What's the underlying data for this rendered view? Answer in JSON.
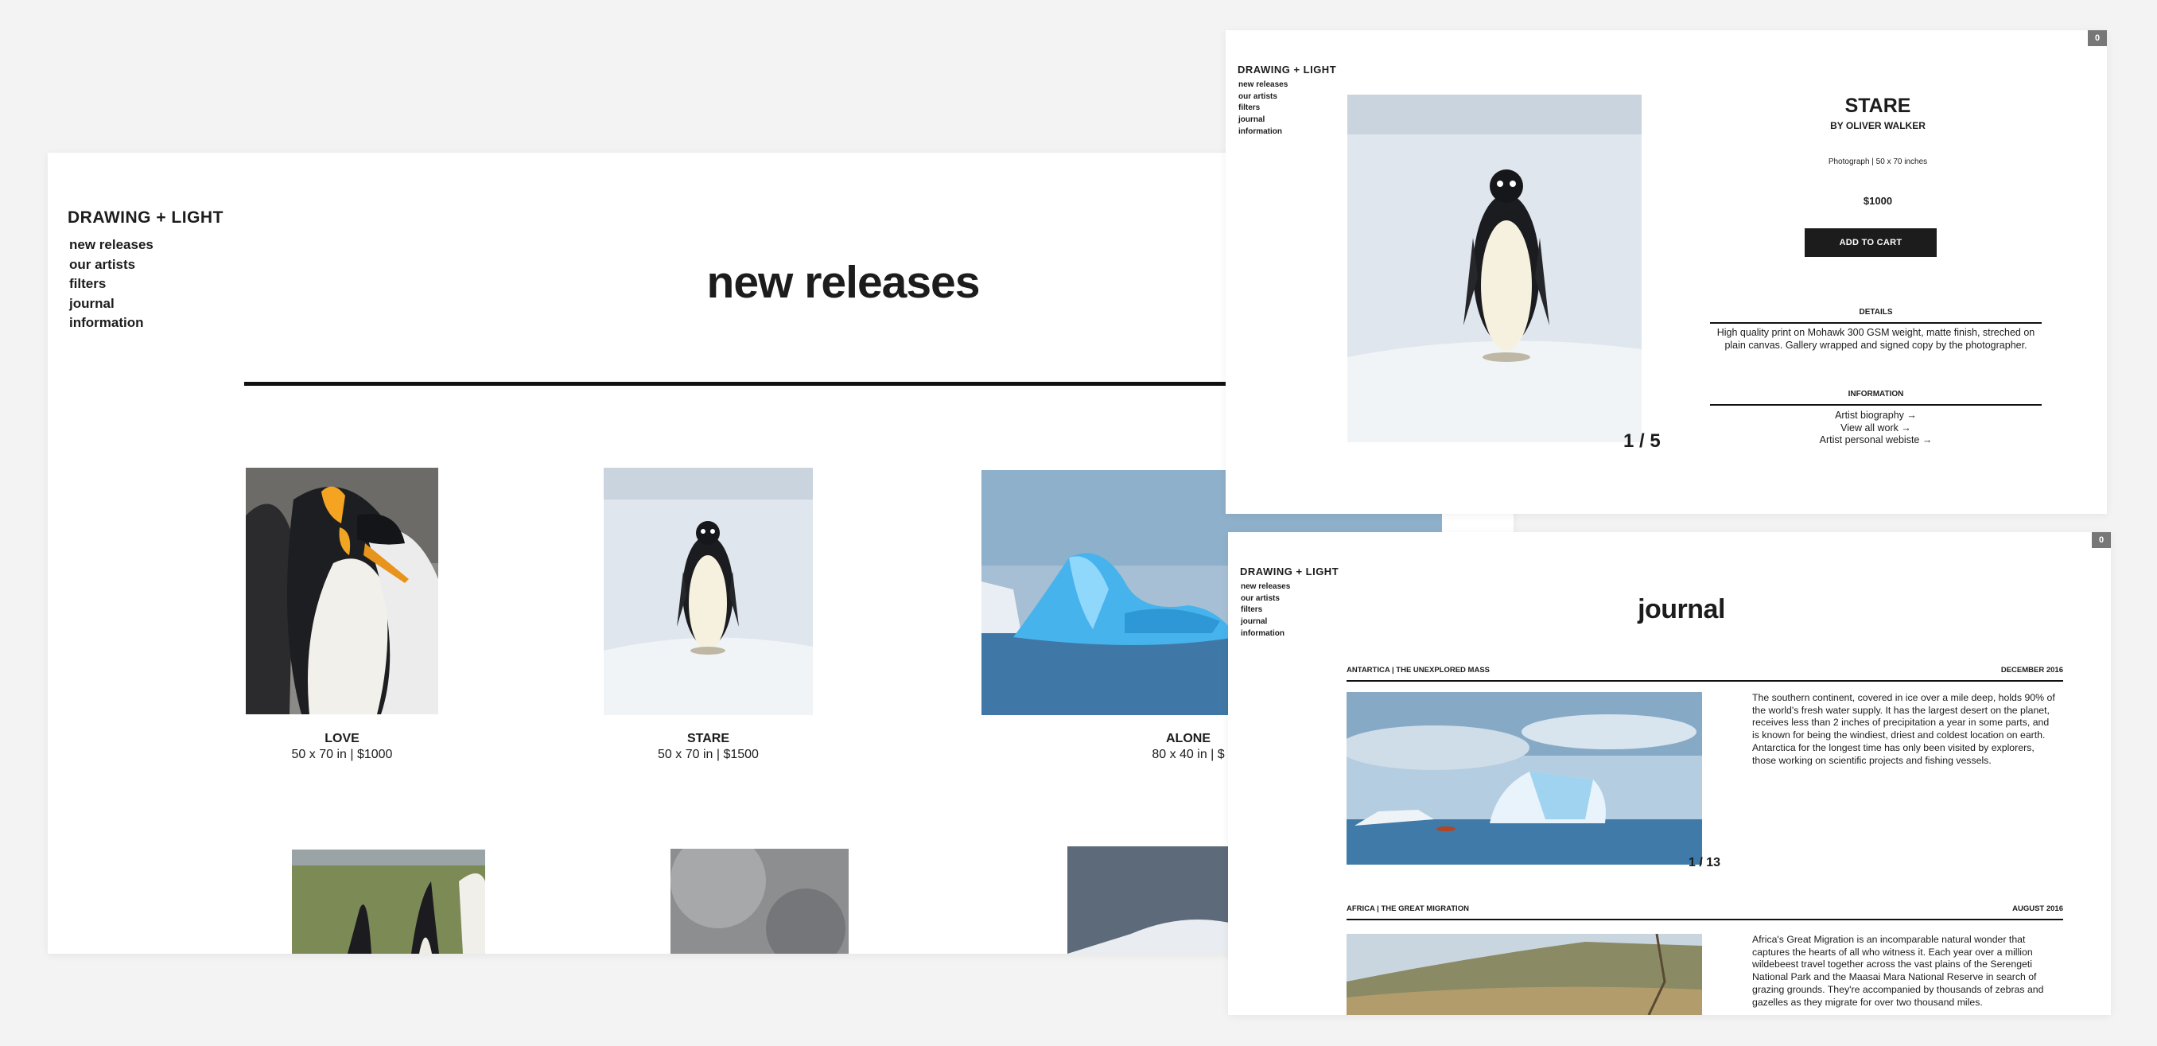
{
  "gallery": {
    "brand": "DRAWING + LIGHT",
    "nav": [
      "new releases",
      "our artists",
      "filters",
      "journal",
      "information"
    ],
    "title": "new releases",
    "artworks": [
      {
        "name": "LOVE",
        "details": "50 x 70 in | $1000"
      },
      {
        "name": "STARE",
        "details": "50 x 70 in | $1500"
      },
      {
        "name": "ALONE",
        "details": "80 x 40 in | $"
      }
    ]
  },
  "product": {
    "brand": "DRAWING + LIGHT",
    "nav": [
      "new releases",
      "our artists",
      "filters",
      "journal",
      "information"
    ],
    "cart_count": "0",
    "title": "STARE",
    "artist": "BY  OLIVER WALKER",
    "meta": "Photograph  |  50 x 70 inches",
    "price": "$1000",
    "add_to_cart": "ADD TO CART",
    "counter": "1 / 5",
    "details_title": "DETAILS",
    "details_text": "High quality print on Mohawk 300 GSM weight, matte finish, streched on plain canvas. Gallery wrapped and signed copy by the photographer.",
    "info_title": "INFORMATION",
    "info_links": [
      "Artist biography →",
      "View all work →",
      "Artist personal webiste →"
    ]
  },
  "journal": {
    "brand": "DRAWING + LIGHT",
    "nav": [
      "new releases",
      "our artists",
      "filters",
      "journal",
      "information"
    ],
    "cart_count": "0",
    "title": "journal",
    "entries": [
      {
        "location": "ANTARTICA | THE UNEXPLORED MASS",
        "date": "DECEMBER 2016",
        "counter": "1 / 13",
        "text": "The southern continent, covered in ice over a mile deep, holds 90% of the world's fresh water supply. It has the largest desert on the planet, receives less than 2 inches of precipitation a year in some parts, and is known for being the windiest, driest and coldest location on earth. Antarctica for the longest time has only been visited by explorers, those working on scientific projects and fishing vessels."
      },
      {
        "location": "AFRICA | THE GREAT MIGRATION",
        "date": "AUGUST 2016",
        "text": "Africa's Great Migration is an incomparable natural wonder that captures the hearts of all who witness it. Each year over a million wildebeest travel together across the vast plains of the Serengeti National Park and the Maasai Mara National Reserve in search of grazing grounds. They're accompanied by thousands of zebras and gazelles as they migrate for over two thousand miles."
      }
    ]
  }
}
